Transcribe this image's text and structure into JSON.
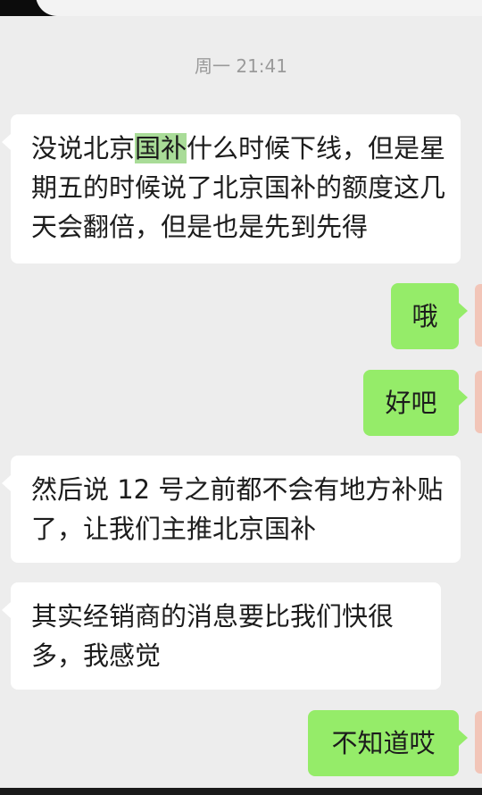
{
  "timestamp": "周一 21:41",
  "messages": [
    {
      "side": "in",
      "pre": "没说北京",
      "hl": "国补",
      "post": "什么时候下线，但是星期五的时候说了北京国补的额度这几天会翻倍，但是也是先到先得"
    },
    {
      "side": "out",
      "text": "哦"
    },
    {
      "side": "out",
      "text": "好吧"
    },
    {
      "side": "in",
      "text": "然后说 12 号之前都不会有地方补贴了，让我们主推北京国补"
    },
    {
      "side": "in",
      "text": "其实经销商的消息要比我们快很多，我感觉"
    },
    {
      "side": "out",
      "text": "不知道哎"
    }
  ],
  "colors": {
    "outgoing": "#95ec69",
    "incoming": "#ffffff",
    "background": "#ededed",
    "highlight": "#a9dc98"
  }
}
